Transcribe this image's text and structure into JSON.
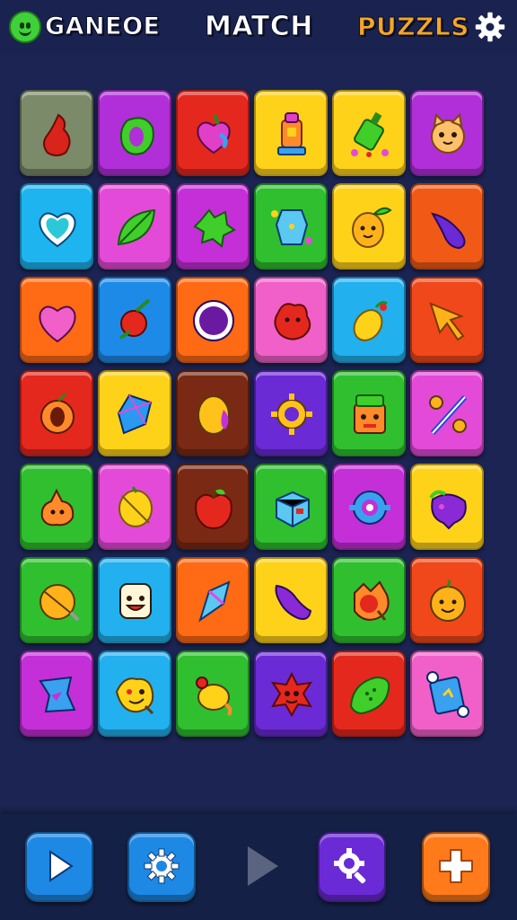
{
  "header": {
    "title_left": "GANEOE",
    "title_center": "MATCH",
    "title_right": "PUZZLS",
    "logo_icon": "smiley-icon",
    "settings_icon": "gear-icon"
  },
  "board": {
    "rows": 7,
    "cols": 6,
    "tiles": [
      {
        "color": "#7b8a68",
        "icon": "chili-pepper-icon"
      },
      {
        "color": "#b12fd8",
        "icon": "green-pepper-icon"
      },
      {
        "color": "#e4281e",
        "icon": "heart-apple-icon"
      },
      {
        "color": "#ffd21a",
        "icon": "tower-toy-icon"
      },
      {
        "color": "#ffd21a",
        "icon": "green-bottle-icon"
      },
      {
        "color": "#b12fd8",
        "icon": "cat-face-icon"
      },
      {
        "color": "#1eb4f0",
        "icon": "heart-icon"
      },
      {
        "color": "#e44ad8",
        "icon": "leaf-icon"
      },
      {
        "color": "#c42fd8",
        "icon": "green-splat-icon"
      },
      {
        "color": "#2fbf2f",
        "icon": "blue-gem-icon"
      },
      {
        "color": "#ffd21a",
        "icon": "lemon-face-icon"
      },
      {
        "color": "#f05a16",
        "icon": "purple-eggplant-icon"
      },
      {
        "color": "#ff6a14",
        "icon": "pink-heart-icon"
      },
      {
        "color": "#1e8ae8",
        "icon": "cherry-icon"
      },
      {
        "color": "#ff6a14",
        "icon": "purple-orb-icon"
      },
      {
        "color": "#f060c8",
        "icon": "red-blob-icon"
      },
      {
        "color": "#22b0ee",
        "icon": "lemon-icon"
      },
      {
        "color": "#f0481a",
        "icon": "arrow-cursor-icon"
      },
      {
        "color": "#e4281e",
        "icon": "apricot-icon"
      },
      {
        "color": "#ffd21a",
        "icon": "blue-crystal-icon"
      },
      {
        "color": "#7a2a14",
        "icon": "gold-egg-icon"
      },
      {
        "color": "#6a2ad6",
        "icon": "gold-ring-icon"
      },
      {
        "color": "#2fbf2f",
        "icon": "robot-box-icon"
      },
      {
        "color": "#e44ad8",
        "icon": "percent-icon"
      },
      {
        "color": "#2fbf2f",
        "icon": "orange-splat-icon"
      },
      {
        "color": "#e44ad8",
        "icon": "lemon-slice-icon"
      },
      {
        "color": "#7a2a14",
        "icon": "red-apple-icon"
      },
      {
        "color": "#2fbf2f",
        "icon": "blue-cube-icon"
      },
      {
        "color": "#c42fd8",
        "icon": "target-ring-icon"
      },
      {
        "color": "#ffd21a",
        "icon": "purple-monster-icon"
      },
      {
        "color": "#2fbf2f",
        "icon": "orange-ball-icon"
      },
      {
        "color": "#22b0ee",
        "icon": "toast-face-icon"
      },
      {
        "color": "#ff6a14",
        "icon": "ice-crystal-icon"
      },
      {
        "color": "#ffd21a",
        "icon": "purple-worm-icon"
      },
      {
        "color": "#2fbf2f",
        "icon": "red-berry-icon"
      },
      {
        "color": "#f0481a",
        "icon": "smiling-orange-icon"
      },
      {
        "color": "#c42fd8",
        "icon": "blue-ribbon-icon"
      },
      {
        "color": "#22b0ee",
        "icon": "cookie-face-icon"
      },
      {
        "color": "#2fbf2f",
        "icon": "yellow-candy-icon"
      },
      {
        "color": "#6a2ad6",
        "icon": "red-star-monster-icon"
      },
      {
        "color": "#e4281e",
        "icon": "green-leaf-icon"
      },
      {
        "color": "#f060c8",
        "icon": "blue-card-icon"
      }
    ]
  },
  "bottom_bar": {
    "buttons": [
      {
        "icon": "play-icon"
      },
      {
        "icon": "settings-gear-icon"
      },
      {
        "icon": "next-arrow-icon"
      },
      {
        "icon": "search-gear-icon"
      },
      {
        "icon": "plus-icon"
      }
    ]
  }
}
